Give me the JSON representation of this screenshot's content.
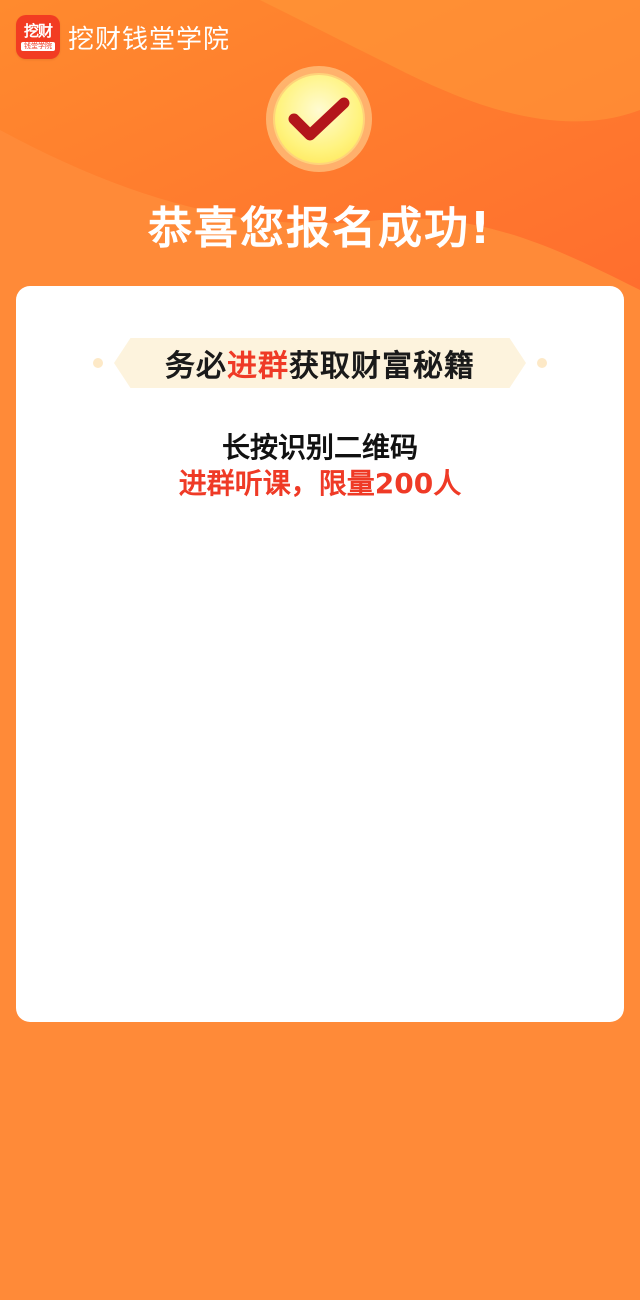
{
  "header": {
    "logo_text": "挖财",
    "logo_sub": "钱堂学院",
    "brand": "挖财钱堂学院"
  },
  "hero": {
    "icon": "check-icon",
    "title": "恭喜您报名成功!"
  },
  "card": {
    "banner_part1": "务必",
    "banner_highlight": "进群",
    "banner_part2": "获取财富秘籍",
    "scan_text": "长按识别二维码",
    "scan_note": "进群听课，限量200人"
  },
  "colors": {
    "background": "#ff8a38",
    "accent": "#ef3a26",
    "banner_bg": "#fdf3dd"
  }
}
